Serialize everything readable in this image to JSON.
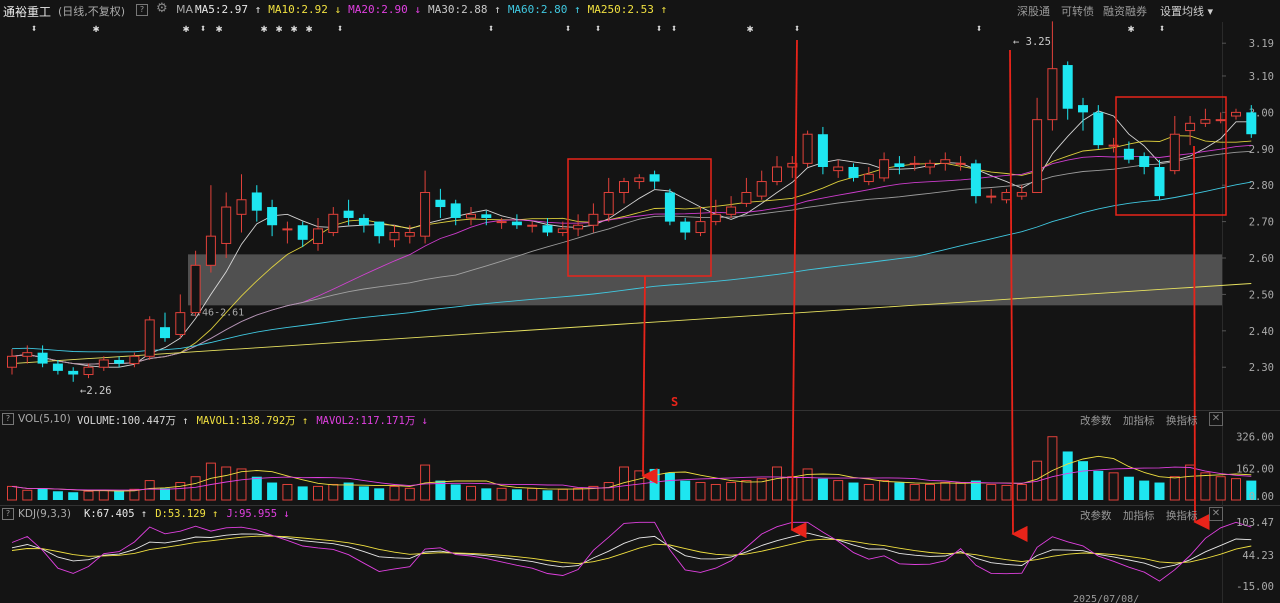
{
  "header": {
    "stock_name": "通裕重工",
    "period": "(日线,不复权)",
    "ma_label": "MA",
    "indicators": [
      {
        "label": "MA5:2.97",
        "arrow": "↑",
        "color": "#e8e8e8"
      },
      {
        "label": "MA10:2.92",
        "arrow": "↓",
        "color": "#f0e040"
      },
      {
        "label": "MA20:2.90",
        "arrow": "↓",
        "color": "#e040e0"
      },
      {
        "label": "MA30:2.88",
        "arrow": "↑",
        "color": "#c8c8c8"
      },
      {
        "label": "MA60:2.80",
        "arrow": "↑",
        "color": "#40c8e0"
      },
      {
        "label": "MA250:2.53",
        "arrow": "↑",
        "color": "#f0e040"
      }
    ],
    "buttons": [
      "深股通",
      "可转债",
      "融资融券",
      "设置均线 ▾"
    ]
  },
  "chart_data": {
    "type": "candlestick",
    "price_axis": {
      "ticks": [
        "3.19",
        "3.10",
        "3.00",
        "2.90",
        "2.80",
        "2.70",
        "2.60",
        "2.50",
        "2.40",
        "2.30"
      ],
      "ylim": [
        2.21,
        3.24
      ]
    },
    "annotations": {
      "high": "3.25",
      "low": "2.26",
      "band_label": "2.46-2.61",
      "band": [
        2.47,
        2.61
      ],
      "marker": "S"
    },
    "date_label": "2025/07/08/",
    "candles": [
      [
        2.3,
        2.33,
        2.28,
        2.35
      ],
      [
        2.33,
        2.34,
        2.31,
        2.36
      ],
      [
        2.34,
        2.31,
        2.3,
        2.36
      ],
      [
        2.31,
        2.29,
        2.28,
        2.32
      ],
      [
        2.29,
        2.28,
        2.26,
        2.3
      ],
      [
        2.28,
        2.3,
        2.27,
        2.31
      ],
      [
        2.3,
        2.32,
        2.29,
        2.33
      ],
      [
        2.32,
        2.31,
        2.3,
        2.33
      ],
      [
        2.31,
        2.33,
        2.3,
        2.34
      ],
      [
        2.33,
        2.43,
        2.32,
        2.44
      ],
      [
        2.41,
        2.38,
        2.37,
        2.45
      ],
      [
        2.39,
        2.45,
        2.38,
        2.5
      ],
      [
        2.45,
        2.58,
        2.44,
        2.62
      ],
      [
        2.58,
        2.66,
        2.56,
        2.8
      ],
      [
        2.64,
        2.74,
        2.6,
        2.78
      ],
      [
        2.72,
        2.76,
        2.67,
        2.83
      ],
      [
        2.78,
        2.73,
        2.7,
        2.8
      ],
      [
        2.74,
        2.69,
        2.66,
        2.76
      ],
      [
        2.68,
        2.68,
        2.64,
        2.7
      ],
      [
        2.69,
        2.65,
        2.63,
        2.7
      ],
      [
        2.64,
        2.68,
        2.62,
        2.71
      ],
      [
        2.67,
        2.72,
        2.66,
        2.74
      ],
      [
        2.73,
        2.71,
        2.69,
        2.76
      ],
      [
        2.71,
        2.69,
        2.67,
        2.72
      ],
      [
        2.7,
        2.66,
        2.64,
        2.7
      ],
      [
        2.65,
        2.67,
        2.63,
        2.69
      ],
      [
        2.66,
        2.67,
        2.64,
        2.69
      ],
      [
        2.66,
        2.78,
        2.64,
        2.84
      ],
      [
        2.76,
        2.74,
        2.71,
        2.79
      ],
      [
        2.75,
        2.71,
        2.69,
        2.76
      ],
      [
        2.71,
        2.72,
        2.69,
        2.74
      ],
      [
        2.72,
        2.71,
        2.69,
        2.73
      ],
      [
        2.7,
        2.7,
        2.68,
        2.71
      ],
      [
        2.7,
        2.69,
        2.68,
        2.72
      ],
      [
        2.69,
        2.69,
        2.67,
        2.7
      ],
      [
        2.69,
        2.67,
        2.66,
        2.71
      ],
      [
        2.67,
        2.68,
        2.66,
        2.7
      ],
      [
        2.68,
        2.69,
        2.66,
        2.72
      ],
      [
        2.69,
        2.72,
        2.67,
        2.75
      ],
      [
        2.72,
        2.78,
        2.7,
        2.82
      ],
      [
        2.78,
        2.81,
        2.75,
        2.82
      ],
      [
        2.81,
        2.82,
        2.79,
        2.83
      ],
      [
        2.83,
        2.81,
        2.79,
        2.84
      ],
      [
        2.78,
        2.7,
        2.69,
        2.79
      ],
      [
        2.7,
        2.67,
        2.65,
        2.71
      ],
      [
        2.67,
        2.7,
        2.66,
        2.74
      ],
      [
        2.7,
        2.72,
        2.69,
        2.76
      ],
      [
        2.72,
        2.74,
        2.71,
        2.77
      ],
      [
        2.75,
        2.78,
        2.74,
        2.82
      ],
      [
        2.77,
        2.81,
        2.76,
        2.84
      ],
      [
        2.81,
        2.85,
        2.8,
        2.88
      ],
      [
        2.85,
        2.86,
        2.82,
        2.88
      ],
      [
        2.86,
        2.94,
        2.85,
        2.95
      ],
      [
        2.94,
        2.85,
        2.83,
        2.96
      ],
      [
        2.84,
        2.85,
        2.82,
        2.87
      ],
      [
        2.85,
        2.82,
        2.81,
        2.86
      ],
      [
        2.81,
        2.83,
        2.8,
        2.85
      ],
      [
        2.82,
        2.87,
        2.81,
        2.89
      ],
      [
        2.86,
        2.85,
        2.83,
        2.88
      ],
      [
        2.86,
        2.86,
        2.84,
        2.88
      ],
      [
        2.85,
        2.86,
        2.83,
        2.87
      ],
      [
        2.86,
        2.87,
        2.84,
        2.89
      ],
      [
        2.86,
        2.86,
        2.84,
        2.88
      ],
      [
        2.86,
        2.77,
        2.75,
        2.87
      ],
      [
        2.77,
        2.77,
        2.75,
        2.79
      ],
      [
        2.76,
        2.78,
        2.75,
        2.79
      ],
      [
        2.77,
        2.78,
        2.76,
        2.8
      ],
      [
        2.78,
        2.98,
        2.78,
        3.04
      ],
      [
        2.98,
        3.12,
        2.95,
        3.25
      ],
      [
        3.13,
        3.01,
        2.98,
        3.14
      ],
      [
        3.02,
        3.0,
        2.95,
        3.04
      ],
      [
        3.0,
        2.91,
        2.9,
        3.02
      ],
      [
        2.91,
        2.91,
        2.89,
        2.93
      ],
      [
        2.9,
        2.87,
        2.86,
        2.92
      ],
      [
        2.88,
        2.85,
        2.83,
        2.89
      ],
      [
        2.85,
        2.77,
        2.76,
        2.87
      ],
      [
        2.84,
        2.94,
        2.83,
        2.99
      ],
      [
        2.95,
        2.97,
        2.91,
        2.99
      ],
      [
        2.97,
        2.98,
        2.96,
        3.01
      ],
      [
        2.98,
        2.98,
        2.97,
        3.0
      ],
      [
        2.99,
        3.0,
        2.98,
        3.01
      ],
      [
        3.0,
        2.94,
        2.93,
        3.02
      ]
    ],
    "volume": {
      "label": "VOL(5,10)",
      "values": [
        {
          "text": "VOLUME:100.447万",
          "color": "#d8d8d8"
        },
        {
          "text": "MAVOL1:138.792万",
          "color": "#f0e040"
        },
        {
          "text": "MAVOL2:117.171万",
          "color": "#e040e0"
        }
      ],
      "arrows": [
        "↑",
        "↑",
        "↓"
      ],
      "ticks": [
        "326.00",
        "162.00",
        "0.00"
      ],
      "ylim": [
        0,
        340
      ],
      "bars": [
        70,
        50,
        60,
        45,
        40,
        45,
        50,
        48,
        55,
        100,
        60,
        90,
        120,
        190,
        170,
        160,
        120,
        90,
        80,
        70,
        70,
        80,
        90,
        70,
        60,
        70,
        60,
        180,
        100,
        80,
        70,
        60,
        60,
        55,
        60,
        50,
        55,
        60,
        70,
        90,
        170,
        150,
        160,
        140,
        100,
        90,
        80,
        90,
        100,
        110,
        170,
        120,
        160,
        110,
        100,
        90,
        80,
        100,
        90,
        80,
        80,
        90,
        90,
        100,
        80,
        75,
        80,
        200,
        326,
        250,
        200,
        150,
        140,
        120,
        100,
        90,
        120,
        180,
        140,
        120,
        110,
        100
      ]
    },
    "kdj": {
      "label": "KDJ(9,3,3)",
      "values": [
        {
          "text": "K:67.405",
          "color": "#e8e8e8"
        },
        {
          "text": "D:53.129",
          "color": "#f0e040"
        },
        {
          "text": "J:95.955",
          "color": "#e040e0"
        }
      ],
      "arrows": [
        "↑",
        "↑",
        "↓"
      ],
      "ticks": [
        "103.47",
        "44.23",
        "-15.00"
      ],
      "ylim": [
        -15,
        103.47
      ]
    },
    "panel_buttons": [
      "改参数",
      "加指标",
      "换指标"
    ]
  },
  "colors": {
    "up": "#e0413a",
    "down": "#1ee6f0",
    "bg": "#141414",
    "box": "#e8241a"
  }
}
